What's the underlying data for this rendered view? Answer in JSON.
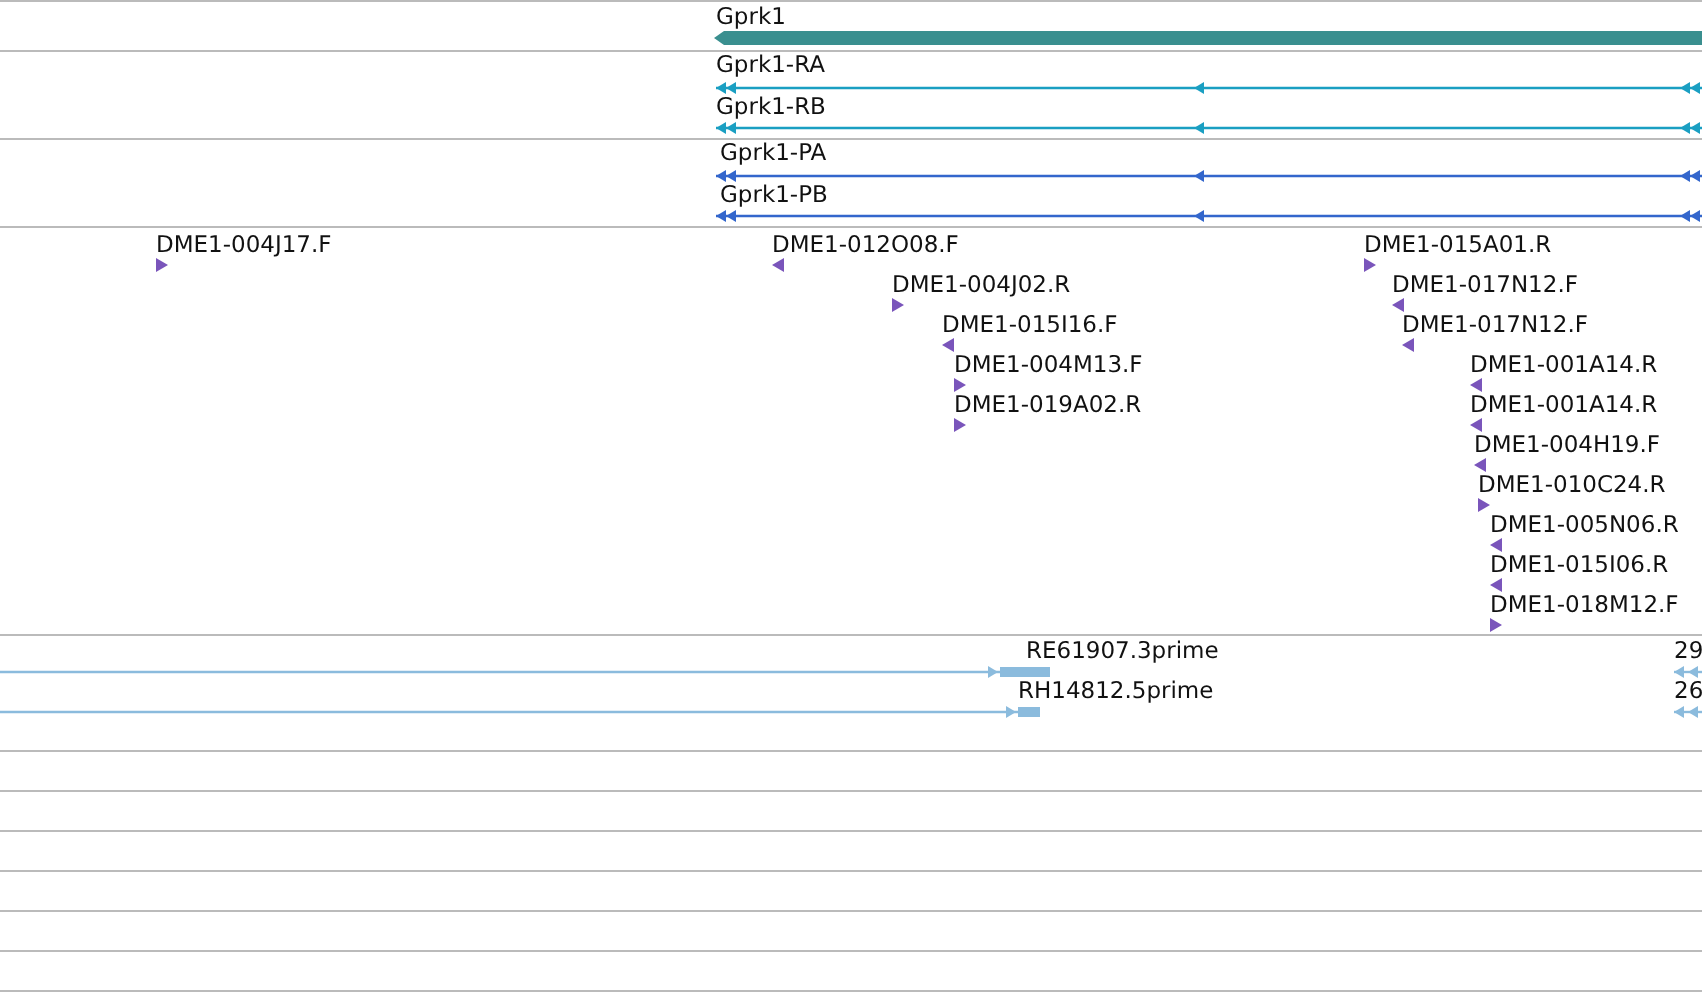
{
  "tracks": [
    {
      "kind": "gene",
      "features": [
        {
          "label": "Gprk1",
          "reverse": true
        }
      ]
    },
    {
      "kind": "transcript",
      "features": [
        {
          "label": "Gprk1-RA",
          "reverse": true
        },
        {
          "label": "Gprk1-RB",
          "reverse": true
        }
      ]
    },
    {
      "kind": "protein",
      "features": [
        {
          "label": "Gprk1-PA",
          "reverse": true
        },
        {
          "label": "Gprk1-PB",
          "reverse": true
        }
      ]
    },
    {
      "kind": "est",
      "features": [
        {
          "label": "DME1-004J17.F",
          "reverse": false
        },
        {
          "label": "DME1-012O08.F",
          "reverse": true
        },
        {
          "label": "DME1-004J02.R",
          "reverse": false
        },
        {
          "label": "DME1-015I16.F",
          "reverse": true
        },
        {
          "label": "DME1-004M13.F",
          "reverse": false
        },
        {
          "label": "DME1-019A02.R",
          "reverse": false
        },
        {
          "label": "DME1-015A01.R",
          "reverse": false
        },
        {
          "label": "DME1-017N12.F",
          "reverse": true
        },
        {
          "label": "DME1-017N12.F",
          "reverse": true
        },
        {
          "label": "DME1-001A14.R",
          "reverse": true
        },
        {
          "label": "DME1-001A14.R",
          "reverse": true
        },
        {
          "label": "DME1-004H19.F",
          "reverse": true
        },
        {
          "label": "DME1-010C24.R",
          "reverse": false
        },
        {
          "label": "DME1-005N06.R",
          "reverse": true
        },
        {
          "label": "DME1-015I06.R",
          "reverse": true
        },
        {
          "label": "DME1-018M12.F",
          "reverse": false
        }
      ]
    },
    {
      "kind": "cdna",
      "features": [
        {
          "label": "RE61907.3prime",
          "reverse": false
        },
        {
          "label": "RH14812.5prime",
          "reverse": false
        },
        {
          "label": "29",
          "reverse": true
        },
        {
          "label": "26",
          "reverse": true
        }
      ]
    }
  ]
}
